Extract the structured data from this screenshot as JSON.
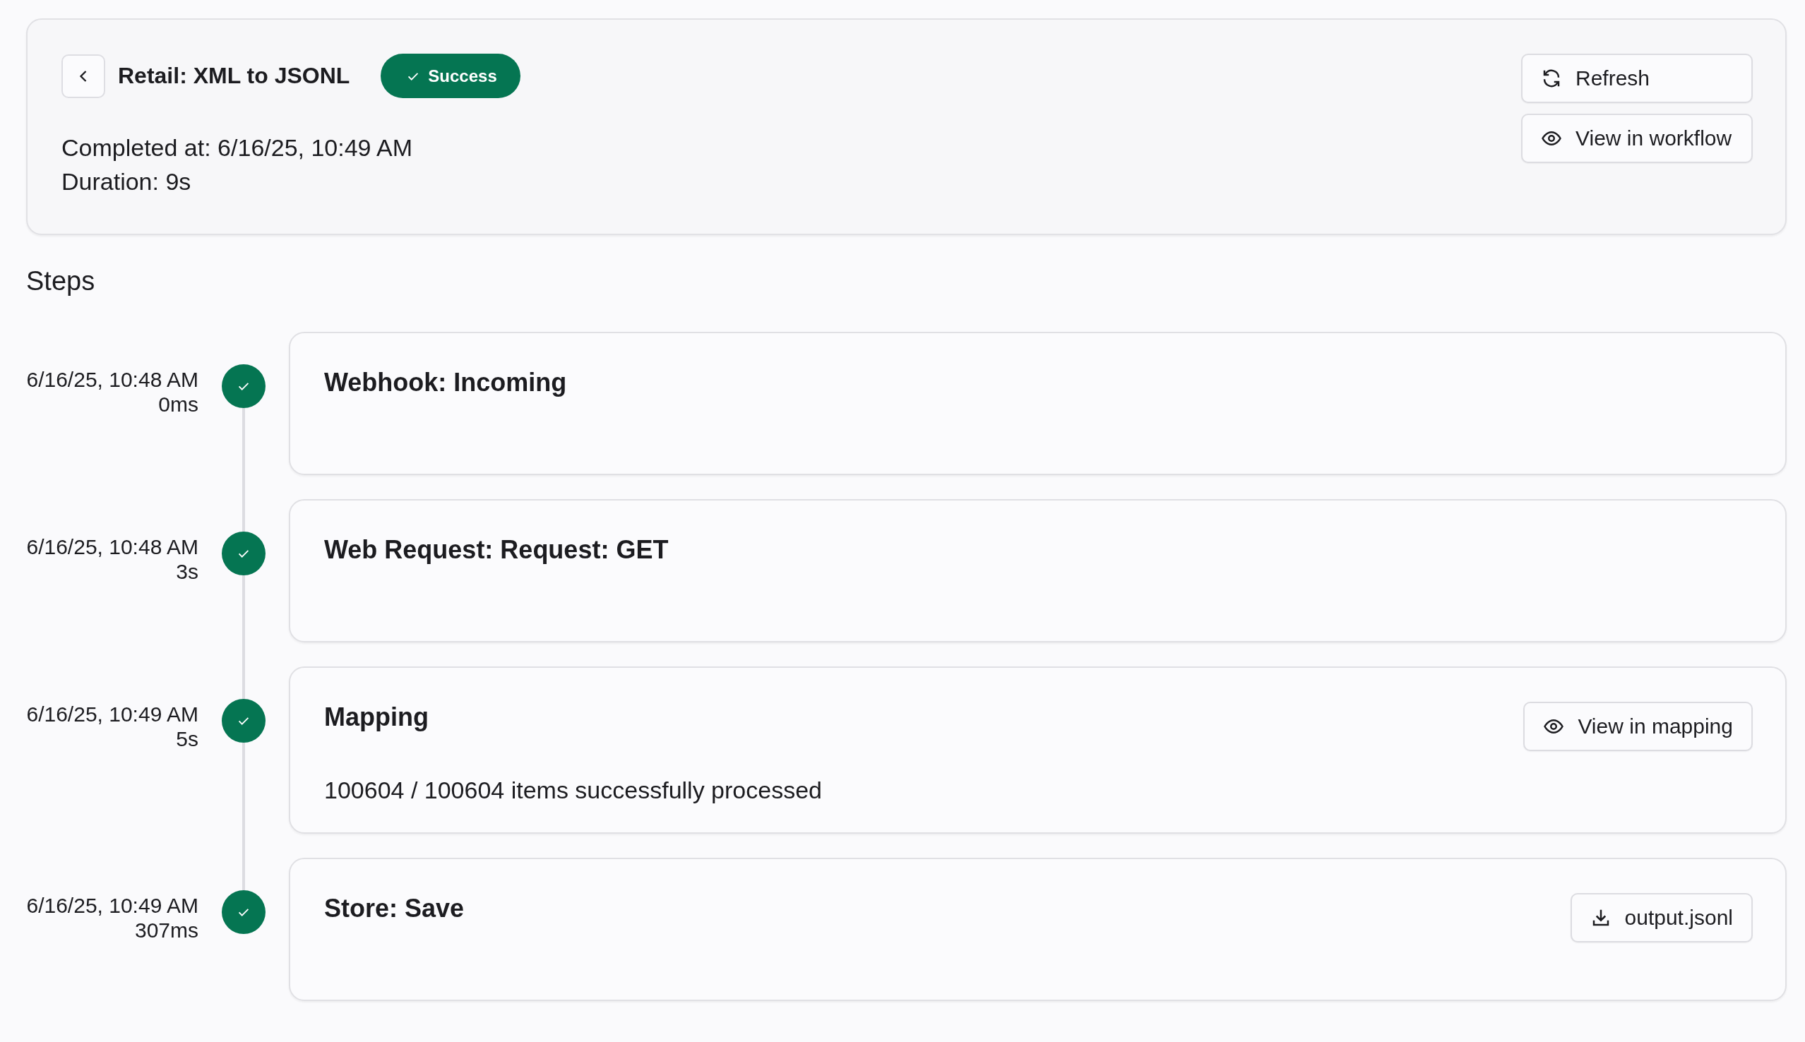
{
  "header": {
    "title": "Retail: XML to JSONL",
    "status": {
      "kind": "success",
      "label": "Success"
    },
    "completed_at": "Completed at: 6/16/25, 10:49 AM",
    "duration": "Duration: 9s",
    "actions": [
      {
        "kind": "refresh",
        "label": "Refresh"
      },
      {
        "kind": "view",
        "label": "View in workflow"
      }
    ]
  },
  "steps_heading": "Steps",
  "steps": [
    {
      "time": "6/16/25, 10:48 AM",
      "elapsed": "0ms",
      "succeeded": true,
      "title": "Webhook: Incoming"
    },
    {
      "time": "6/16/25, 10:48 AM",
      "elapsed": "3s",
      "succeeded": true,
      "title": "Web Request: Request: GET"
    },
    {
      "time": "6/16/25, 10:49 AM",
      "elapsed": "5s",
      "succeeded": true,
      "title": "Mapping",
      "action": {
        "kind": "view",
        "label": "View in mapping"
      },
      "detail": "100604 / 100604 items successfully processed"
    },
    {
      "time": "6/16/25, 10:49 AM",
      "elapsed": "307ms",
      "succeeded": true,
      "title": "Store: Save",
      "action": {
        "kind": "download",
        "label": "output.jsonl"
      }
    }
  ]
}
